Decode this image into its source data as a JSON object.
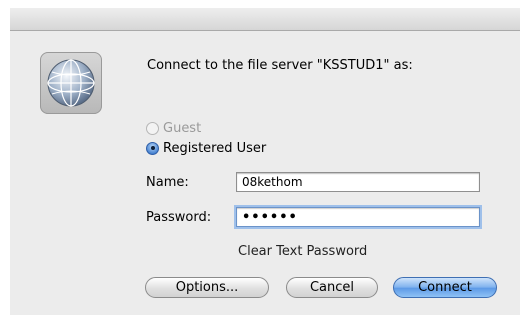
{
  "dialog": {
    "prompt": "Connect to the file server \"KSSTUD1\" as:",
    "icon": "network-globe-icon"
  },
  "login_type": {
    "guest_label": "Guest",
    "registered_label": "Registered User",
    "selected": "Registered User"
  },
  "fields": {
    "name_label": "Name:",
    "name_value": "08kethom",
    "password_label": "Password:",
    "password_value": "••••••"
  },
  "hint": "Clear Text Password",
  "buttons": {
    "options": "Options...",
    "cancel": "Cancel",
    "connect": "Connect"
  },
  "colors": {
    "accent": "#5b98e6",
    "sheet_background": "#ececec"
  }
}
